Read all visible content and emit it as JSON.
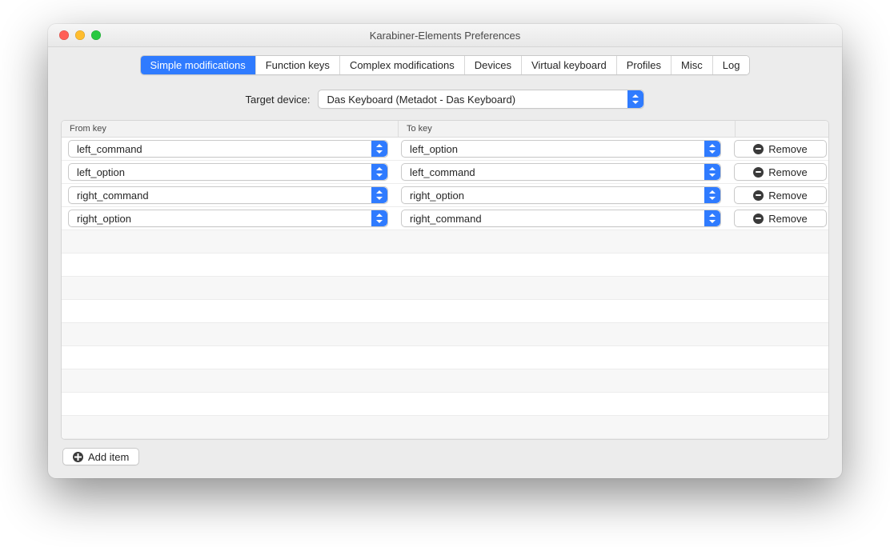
{
  "window": {
    "title": "Karabiner-Elements Preferences"
  },
  "tabs": {
    "items": [
      {
        "label": "Simple modifications",
        "active": true
      },
      {
        "label": "Function keys"
      },
      {
        "label": "Complex modifications"
      },
      {
        "label": "Devices"
      },
      {
        "label": "Virtual keyboard"
      },
      {
        "label": "Profiles"
      },
      {
        "label": "Misc"
      },
      {
        "label": "Log"
      }
    ]
  },
  "target": {
    "label": "Target device:",
    "value": "Das Keyboard (Metadot - Das Keyboard)"
  },
  "table": {
    "headers": {
      "from": "From key",
      "to": "To key"
    },
    "rows": [
      {
        "from": "left_command",
        "to": "left_option",
        "remove": "Remove"
      },
      {
        "from": "left_option",
        "to": "left_command",
        "remove": "Remove"
      },
      {
        "from": "right_command",
        "to": "right_option",
        "remove": "Remove"
      },
      {
        "from": "right_option",
        "to": "right_command",
        "remove": "Remove"
      }
    ],
    "empty_rows": 9
  },
  "footer": {
    "add_label": "Add item"
  }
}
